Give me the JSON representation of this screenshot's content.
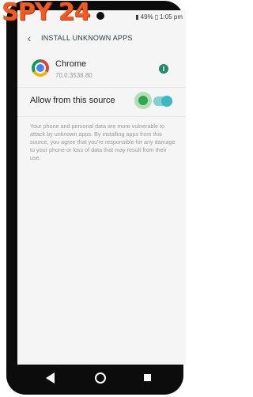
{
  "brand": {
    "logo_text": "SPY 24"
  },
  "status_bar": {
    "battery_percent": "49%",
    "time": "1:05 pm"
  },
  "app_bar": {
    "title": "INSTALL UNKNOWN APPS"
  },
  "app_entry": {
    "name": "Chrome",
    "version": "70.0.3538.80",
    "icon": "chrome-icon",
    "info_glyph": "i"
  },
  "setting": {
    "label": "Allow from this source",
    "enabled": true
  },
  "description": "Your phone and personal data are more vulnerable to attack by unknown apps. By installing apps from this source, you agree that you're responsible for any damage to your phone or loss of data that may result from their use.",
  "colors": {
    "brand": "#f15a22",
    "toggle_on": "#3fb6c2",
    "tap_indicator": "#2fa84a",
    "info": "#1f8a6b"
  }
}
